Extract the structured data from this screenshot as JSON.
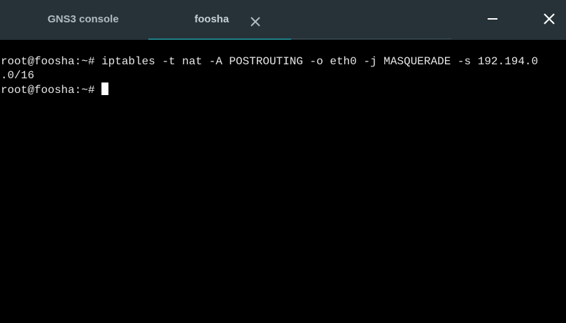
{
  "tabs": [
    {
      "label": "GNS3 console",
      "active": false
    },
    {
      "label": "foosha",
      "active": true
    }
  ],
  "icons": {
    "tab_close": "close-icon",
    "minimize": "minimize-icon",
    "window_close": "close-icon"
  },
  "colors": {
    "header_bg": "#263238",
    "tab_indicator": "#1e7f87",
    "terminal_bg": "#000000",
    "terminal_fg": "#e6e6e6",
    "cursor": "#ffffff"
  },
  "terminal": {
    "lines": [
      "root@foosha:~# iptables -t nat -A POSTROUTING -o eth0 -j MASQUERADE -s 192.194.0",
      ".0/16",
      "root@foosha:~# "
    ]
  }
}
